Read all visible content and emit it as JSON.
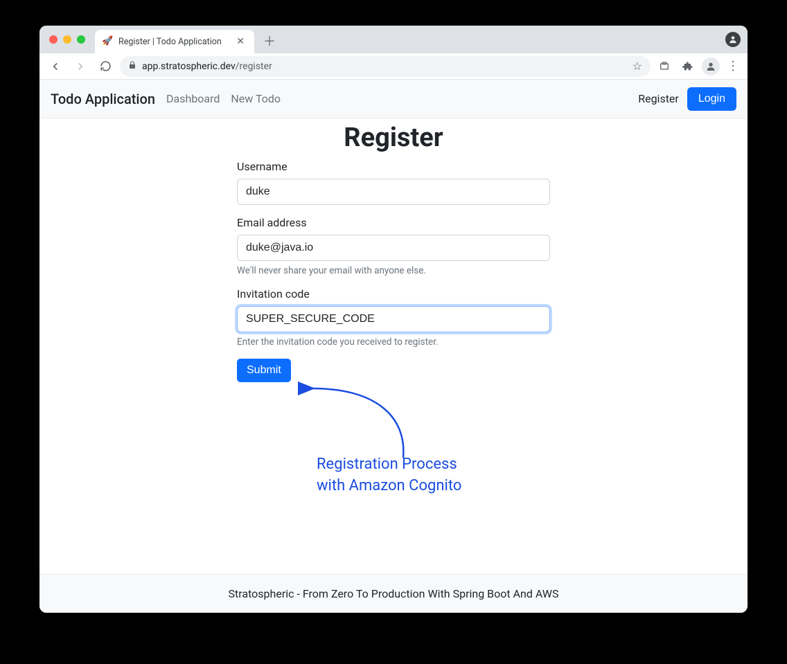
{
  "browser": {
    "tab_title": "Register | Todo Application",
    "url_host": "app.stratospheric.dev",
    "url_path": "/register"
  },
  "navbar": {
    "brand": "Todo Application",
    "links": [
      "Dashboard",
      "New Todo"
    ],
    "register_label": "Register",
    "login_label": "Login"
  },
  "page": {
    "title": "Register"
  },
  "form": {
    "username": {
      "label": "Username",
      "value": "duke"
    },
    "email": {
      "label": "Email address",
      "value": "duke@java.io",
      "help": "We'll never share your email with anyone else."
    },
    "invitation": {
      "label": "Invitation code",
      "value": "SUPER_SECURE_CODE",
      "help": "Enter the invitation code you received to register."
    },
    "submit_label": "Submit"
  },
  "annotation": {
    "line1": "Registration Process",
    "line2": "with Amazon Cognito"
  },
  "footer": {
    "text": "Stratospheric - From Zero To Production With Spring Boot And AWS"
  }
}
